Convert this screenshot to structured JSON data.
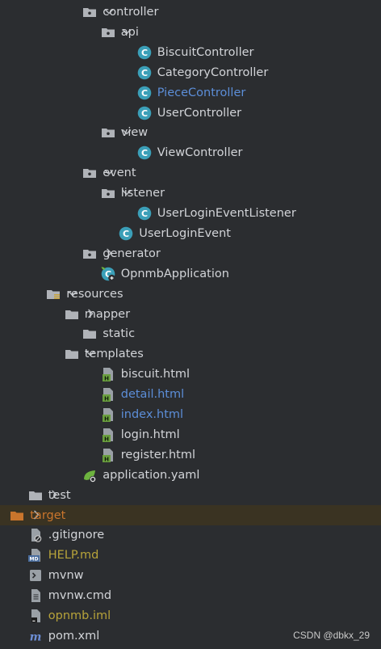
{
  "tree": {
    "rows": [
      {
        "label": "controller",
        "indent": 5,
        "expand": "expanded",
        "icon": "folder-icon",
        "color": "default"
      },
      {
        "label": "api",
        "indent": 6,
        "expand": "expanded",
        "icon": "folder-icon",
        "color": "default"
      },
      {
        "label": "BiscuitController",
        "indent": 8,
        "expand": "none",
        "icon": "class-icon",
        "color": "default"
      },
      {
        "label": "CategoryController",
        "indent": 8,
        "expand": "none",
        "icon": "class-icon",
        "color": "default"
      },
      {
        "label": "PieceController",
        "indent": 8,
        "expand": "none",
        "icon": "class-icon",
        "color": "blue"
      },
      {
        "label": "UserController",
        "indent": 8,
        "expand": "none",
        "icon": "class-icon",
        "color": "default"
      },
      {
        "label": "view",
        "indent": 6,
        "expand": "expanded",
        "icon": "folder-icon",
        "color": "default"
      },
      {
        "label": "ViewController",
        "indent": 8,
        "expand": "none",
        "icon": "class-icon",
        "color": "default"
      },
      {
        "label": "event",
        "indent": 5,
        "expand": "expanded",
        "icon": "folder-icon",
        "color": "default"
      },
      {
        "label": "listener",
        "indent": 6,
        "expand": "expanded",
        "icon": "folder-icon",
        "color": "default"
      },
      {
        "label": "UserLoginEventListener",
        "indent": 8,
        "expand": "none",
        "icon": "class-icon",
        "color": "default"
      },
      {
        "label": "UserLoginEvent",
        "indent": 7,
        "expand": "none",
        "icon": "class-icon",
        "color": "default"
      },
      {
        "label": "generator",
        "indent": 5,
        "expand": "collapsed",
        "icon": "folder-icon",
        "color": "default"
      },
      {
        "label": "OpnmbApplication",
        "indent": 6,
        "expand": "none",
        "icon": "spring-app-icon",
        "color": "default"
      },
      {
        "label": "resources",
        "indent": 3,
        "expand": "expanded",
        "icon": "resources-folder-icon",
        "color": "default"
      },
      {
        "label": "mapper",
        "indent": 4,
        "expand": "collapsed",
        "icon": "plain-folder-icon",
        "color": "default"
      },
      {
        "label": "static",
        "indent": 5,
        "expand": "none",
        "icon": "plain-folder-icon",
        "color": "default"
      },
      {
        "label": "templates",
        "indent": 4,
        "expand": "expanded",
        "icon": "plain-folder-icon",
        "color": "default"
      },
      {
        "label": "biscuit.html",
        "indent": 6,
        "expand": "none",
        "icon": "html-file-icon",
        "color": "default"
      },
      {
        "label": "detail.html",
        "indent": 6,
        "expand": "none",
        "icon": "html-file-icon",
        "color": "blue"
      },
      {
        "label": "index.html",
        "indent": 6,
        "expand": "none",
        "icon": "html-file-icon",
        "color": "blue"
      },
      {
        "label": "login.html",
        "indent": 6,
        "expand": "none",
        "icon": "html-file-icon",
        "color": "default"
      },
      {
        "label": "register.html",
        "indent": 6,
        "expand": "none",
        "icon": "html-file-icon",
        "color": "default"
      },
      {
        "label": "application.yaml",
        "indent": 5,
        "expand": "none",
        "icon": "spring-yaml-icon",
        "color": "default"
      },
      {
        "label": "test",
        "indent": 2,
        "expand": "collapsed",
        "icon": "plain-folder-icon",
        "color": "default"
      },
      {
        "label": "target",
        "indent": 1,
        "expand": "collapsed",
        "icon": "excluded-folder-icon",
        "color": "orange",
        "selected": true
      },
      {
        "label": ".gitignore",
        "indent": 2,
        "expand": "none",
        "icon": "ignore-file-icon",
        "color": "default"
      },
      {
        "label": "HELP.md",
        "indent": 2,
        "expand": "none",
        "icon": "markdown-file-icon",
        "color": "yellow"
      },
      {
        "label": "mvnw",
        "indent": 2,
        "expand": "none",
        "icon": "terminal-file-icon",
        "color": "default"
      },
      {
        "label": "mvnw.cmd",
        "indent": 2,
        "expand": "none",
        "icon": "text-file-icon",
        "color": "default"
      },
      {
        "label": "opnmb.iml",
        "indent": 2,
        "expand": "none",
        "icon": "iml-file-icon",
        "color": "yellow"
      },
      {
        "label": "pom.xml",
        "indent": 2,
        "expand": "none",
        "icon": "maven-file-icon",
        "color": "default"
      }
    ]
  },
  "watermark": {
    "text": "CSDN @dbkx_29"
  },
  "colors": {
    "background": "#2b2d30",
    "text_default": "#d2d4d8",
    "text_blue": "#5c8ed8",
    "text_yellow": "#b7a33a",
    "text_orange": "#c9752c",
    "class_icon": "#3b9fb8",
    "folder_icon": "#b0b3b8",
    "html_icon": "#6a9e3f",
    "selected_row": "#3a3322"
  }
}
